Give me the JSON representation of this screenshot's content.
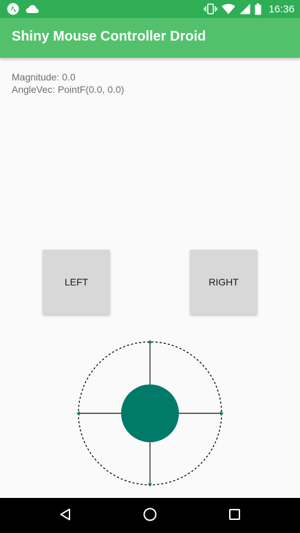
{
  "status_bar": {
    "time": "16:36",
    "icons": [
      "app-notification-icon",
      "cloud-icon",
      "vibrate-icon",
      "wifi-icon",
      "signal-icon",
      "battery-icon"
    ],
    "background": "#2fae56"
  },
  "app_bar": {
    "title": "Shiny Mouse Controller Droid",
    "background": "#53c16c"
  },
  "info": {
    "magnitude": "Magnitude: 0.0",
    "angle_vec": "AngleVec: PointF(0.0, 0.0)"
  },
  "buttons": {
    "left_label": "LEFT",
    "right_label": "RIGHT"
  },
  "joystick": {
    "knob_color": "#007a69",
    "magnitude": 0.0,
    "angle_vec": [
      0.0,
      0.0
    ]
  },
  "nav_bar": {
    "icons": [
      "back-icon",
      "home-icon",
      "recents-icon"
    ]
  }
}
